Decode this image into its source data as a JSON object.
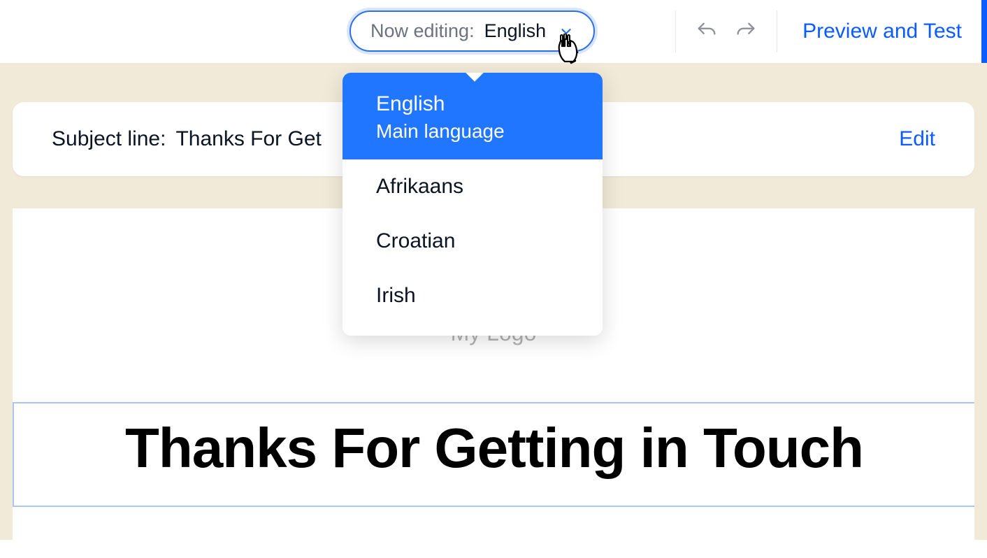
{
  "toolbar": {
    "languageSelector": {
      "label": "Now editing:",
      "value": "English"
    },
    "previewButton": "Preview and Test"
  },
  "dropdown": {
    "items": [
      {
        "label": "English",
        "sub": "Main language",
        "selected": true
      },
      {
        "label": "Afrikaans",
        "selected": false
      },
      {
        "label": "Croatian",
        "selected": false
      },
      {
        "label": "Irish",
        "selected": false
      }
    ]
  },
  "subject": {
    "label": "Subject line:",
    "value": "Thanks For Get",
    "editLabel": "Edit"
  },
  "logo": {
    "text": "My Logo"
  },
  "headline": "Thanks For Getting in Touch"
}
